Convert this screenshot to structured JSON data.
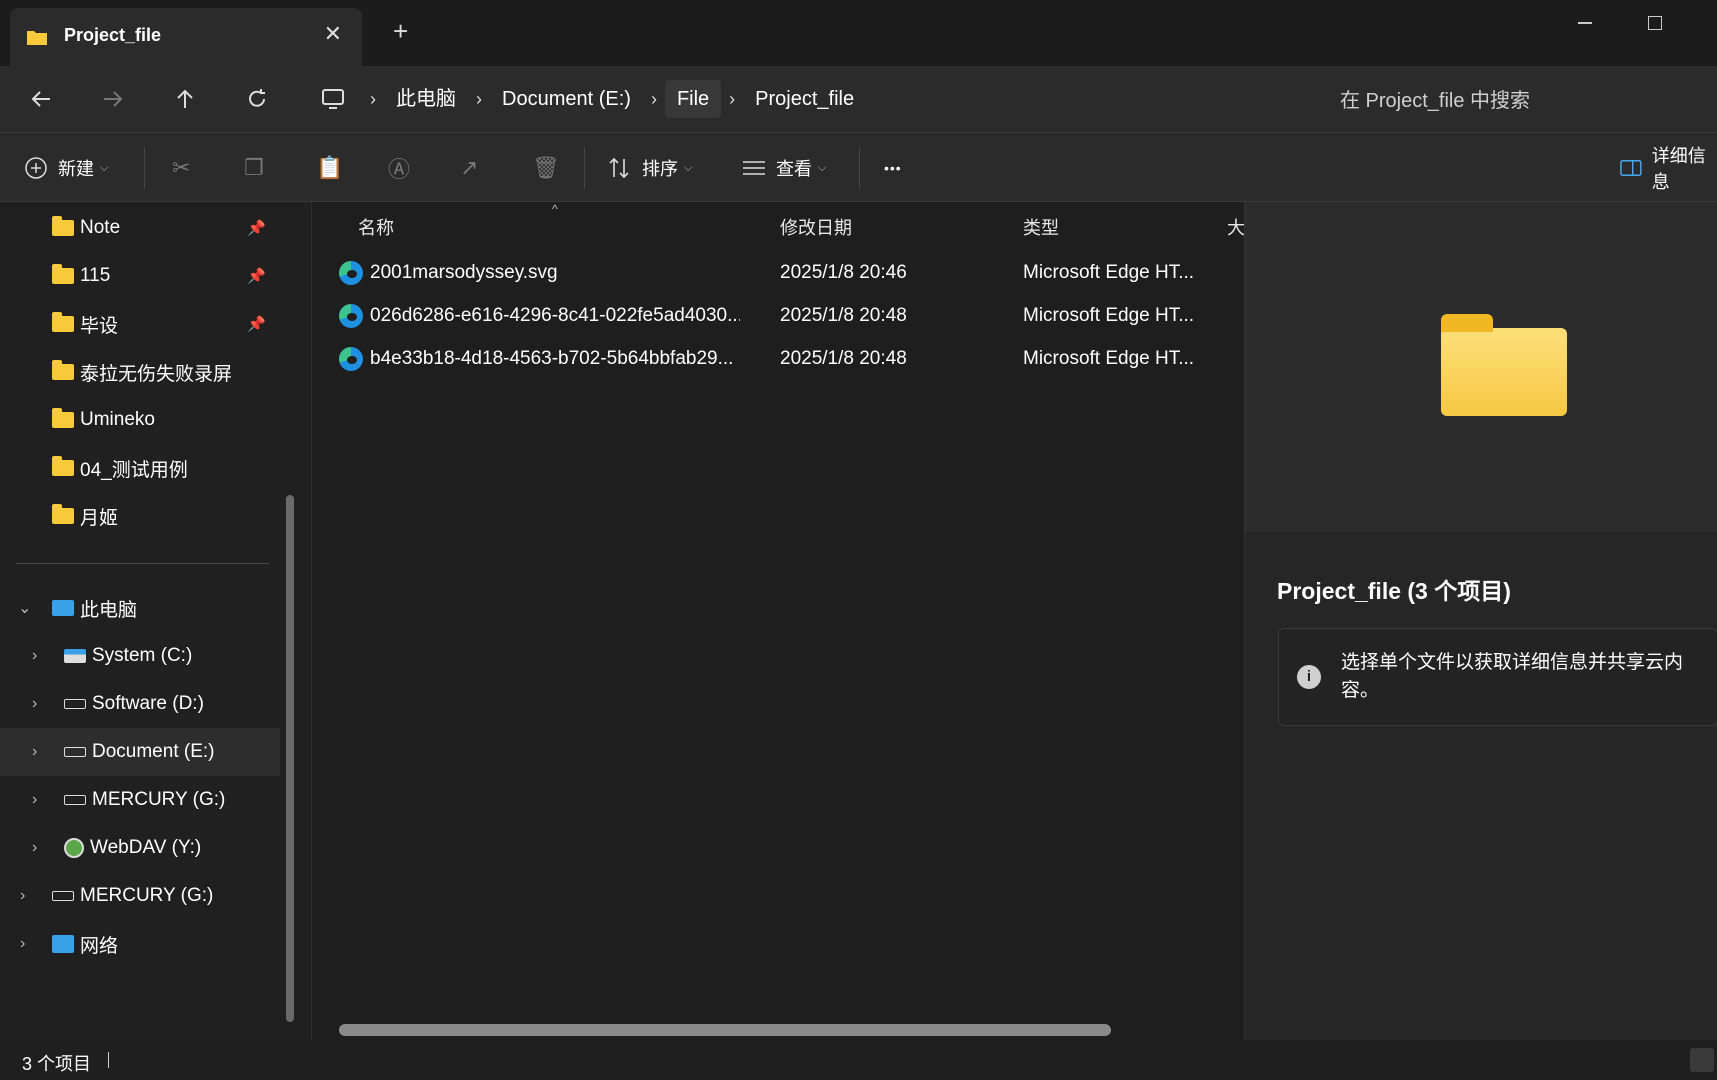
{
  "titlebar": {
    "tab_title": "Project_file",
    "close_glyph": "✕",
    "new_tab_glyph": "+"
  },
  "addressbar": {
    "crumbs": [
      "此电脑",
      "Document (E:)",
      "File",
      "Project_file"
    ],
    "separator": "›",
    "search_placeholder": "在 Project_file 中搜索"
  },
  "toolbar": {
    "new_label": "新建",
    "sort_label": "排序",
    "view_label": "查看",
    "more_glyph": "•••",
    "details_label": "详细信息"
  },
  "sidebar": {
    "quick_access": [
      {
        "label": "Note",
        "pinned": true
      },
      {
        "label": "115",
        "pinned": true
      },
      {
        "label": "毕设",
        "pinned": true
      },
      {
        "label": "泰拉无伤失败录屏",
        "pinned": false
      },
      {
        "label": "Umineko",
        "pinned": false
      },
      {
        "label": "04_测试用例",
        "pinned": false
      },
      {
        "label": "月姬",
        "pinned": false
      }
    ],
    "this_pc": "此电脑",
    "drives": [
      {
        "label": "System (C:)"
      },
      {
        "label": "Software (D:)"
      },
      {
        "label": "Document (E:)",
        "selected": true
      },
      {
        "label": "MERCURY (G:)"
      },
      {
        "label": "WebDAV (Y:)"
      }
    ],
    "mercury_root": "MERCURY (G:)",
    "network": "网络",
    "pin_glyph": "📌"
  },
  "list": {
    "columns": [
      "名称",
      "修改日期",
      "类型",
      "大"
    ],
    "rows": [
      {
        "name": "2001marsodyssey.svg",
        "date": "2025/1/8 20:46",
        "type": "Microsoft Edge HT..."
      },
      {
        "name": "026d6286-e616-4296-8c41-022fe5ad4030...",
        "date": "2025/1/8 20:48",
        "type": "Microsoft Edge HT..."
      },
      {
        "name": "b4e33b18-4d18-4563-b702-5b64bbfab29...",
        "date": "2025/1/8 20:48",
        "type": "Microsoft Edge HT..."
      }
    ]
  },
  "details": {
    "title": "Project_file (3 个项目)",
    "info_text": "选择单个文件以获取详细信息并共享云内容。",
    "info_glyph": "i"
  },
  "status": {
    "count": "3 个项目"
  }
}
